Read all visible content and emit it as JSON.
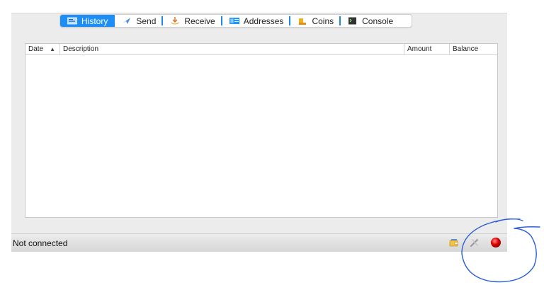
{
  "tabs": [
    {
      "label": "History",
      "icon": "history-icon",
      "active": true
    },
    {
      "label": "Send",
      "icon": "send-icon",
      "active": false
    },
    {
      "label": "Receive",
      "icon": "receive-icon",
      "active": false
    },
    {
      "label": "Addresses",
      "icon": "addresses-icon",
      "active": false
    },
    {
      "label": "Coins",
      "icon": "coins-icon",
      "active": false
    },
    {
      "label": "Console",
      "icon": "console-icon",
      "active": false
    }
  ],
  "history_table": {
    "columns": [
      {
        "label": "Date",
        "sorted": "ascending"
      },
      {
        "label": "Description"
      },
      {
        "label": "Amount"
      },
      {
        "label": "Balance"
      }
    ],
    "rows": []
  },
  "status_bar": {
    "text": "Not connected",
    "icons": [
      "wallet-icon",
      "preferences-icon",
      "network-status-icon"
    ]
  },
  "colors": {
    "accent": "#1e8ef7",
    "network_status": "#e00000",
    "annotation": "#2a5fd8"
  }
}
